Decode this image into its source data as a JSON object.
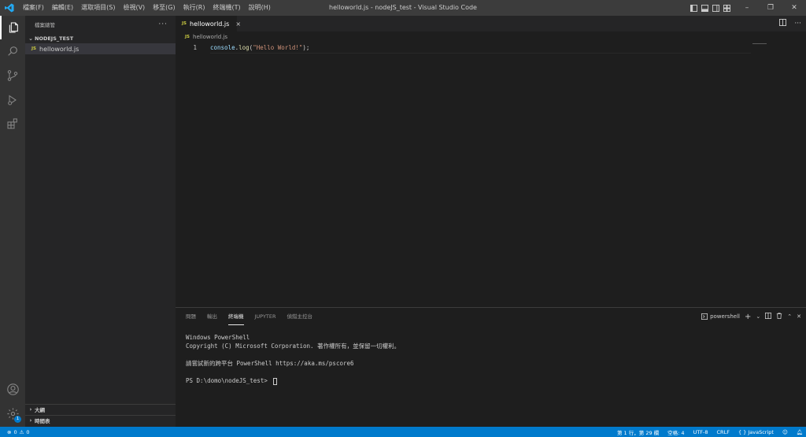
{
  "titlebar": {
    "menus": [
      "檔案(F)",
      "編輯(E)",
      "選取項目(S)",
      "檢視(V)",
      "移至(G)",
      "執行(R)",
      "終端機(T)",
      "說明(H)"
    ],
    "window_title": "helloworld.js - nodeJS_test - Visual Studio Code",
    "minimize": "–",
    "restore": "❐",
    "close": "✕"
  },
  "activitybar": {
    "icons": [
      "explorer-icon",
      "search-icon",
      "source-control-icon",
      "run-debug-icon",
      "extensions-icon",
      "account-icon",
      "settings-gear-icon"
    ],
    "settings_badge": "1"
  },
  "sidebar": {
    "title": "檔案總管",
    "more": "···",
    "folder": "NODEJS_TEST",
    "files": [
      {
        "badge": "JS",
        "name": "helloworld.js"
      }
    ],
    "outline": "大綱",
    "timeline": "時間表"
  },
  "editor": {
    "tab": {
      "badge": "JS",
      "label": "helloworld.js",
      "close": "×"
    },
    "breadcrumb": {
      "badge": "JS",
      "label": "helloworld.js"
    },
    "lines": [
      {
        "number": "1",
        "tokens": [
          {
            "type": "id",
            "text": "console"
          },
          {
            "type": "punc",
            "text": "."
          },
          {
            "type": "fn",
            "text": "log"
          },
          {
            "type": "punc",
            "text": "("
          },
          {
            "type": "str",
            "text": "\"Hello World!\""
          },
          {
            "type": "punc",
            "text": ");"
          }
        ]
      }
    ]
  },
  "panel": {
    "tabs": [
      {
        "label": "問題",
        "active": false
      },
      {
        "label": "輸出",
        "active": false
      },
      {
        "label": "終端機",
        "active": true
      },
      {
        "label": "JUPYTER",
        "active": false
      },
      {
        "label": "偵錯主控台",
        "active": false
      }
    ],
    "terminal_name": "powershell",
    "terminal_lines": [
      "Windows PowerShell",
      "Copyright (C) Microsoft Corporation. 著作權所有，並保留一切權利。",
      "",
      "請嘗試新的跨平台 PowerShell https://aka.ms/pscore6",
      "",
      "PS D:\\domo\\nodeJS_test> "
    ]
  },
  "statusbar": {
    "errors": "0",
    "warnings": "0",
    "position": "第 1 行，第 29 欄",
    "spaces": "空格: 4",
    "encoding": "UTF-8",
    "eol": "CRLF",
    "language": "JavaScript",
    "language_icon": "{ }"
  },
  "colors": {
    "accent": "#007acc",
    "titlebar": "#3c3c3c",
    "activitybar": "#333333",
    "sidebar": "#252526",
    "editor": "#1e1e1e"
  }
}
